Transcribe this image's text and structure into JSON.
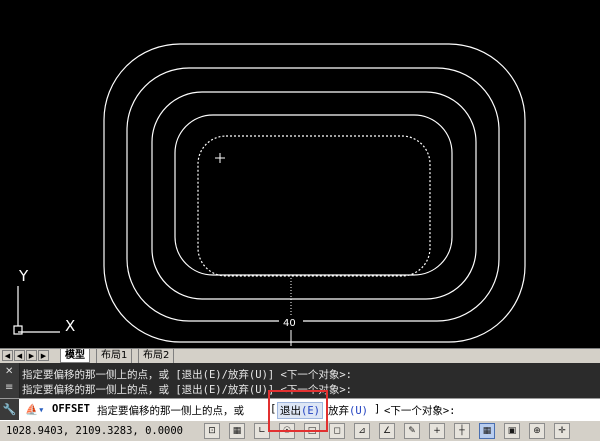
{
  "canvas": {
    "ucs_y_label": "Y",
    "ucs_x_label": "X",
    "dimension_label": "40"
  },
  "tabs": {
    "nav_buttons": [
      "first-icon",
      "prev-icon",
      "next-icon",
      "last-icon"
    ],
    "items": [
      {
        "label": "模型",
        "active": true
      },
      {
        "label": "布局1",
        "active": false
      },
      {
        "label": "布局2",
        "active": false
      }
    ]
  },
  "history": {
    "lines": [
      "指定要偏移的那一侧上的点，或 [退出(E)/放弃(U)] <下一个对象>:",
      "指定要偏移的那一侧上的点，或 [退出(E)/放弃(U)] <下一个对象>:"
    ]
  },
  "command": {
    "command_name": "OFFSET",
    "prompt_text": "指定要偏移的那一侧上的点，或",
    "bracket_open": "[",
    "option_exit_label": "退出",
    "option_exit_key": "(E)",
    "option_undo_label": "放弃",
    "option_undo_key": "(U)",
    "bracket_close": "]",
    "default_text": "<下一个对象>:"
  },
  "statusbar": {
    "coordinates": "1028.9403, 2109.3283, 0.0000",
    "buttons": [
      {
        "name": "snap-mode-icon",
        "glyph": "⊡",
        "on": false
      },
      {
        "name": "grid-display-icon",
        "glyph": "▦",
        "on": false
      },
      {
        "name": "ortho-mode-icon",
        "glyph": "∟",
        "on": false
      },
      {
        "name": "polar-tracking-icon",
        "glyph": "☉",
        "on": false
      },
      {
        "name": "object-snap-icon",
        "glyph": "□",
        "on": false
      },
      {
        "name": "3d-osnap-icon",
        "glyph": "◻",
        "on": false
      },
      {
        "name": "object-snap-tracking-icon",
        "glyph": "⊿",
        "on": false
      },
      {
        "name": "dynamic-ucs-icon",
        "glyph": "∠",
        "on": false
      },
      {
        "name": "dynamic-input-icon",
        "glyph": "✎",
        "on": false
      },
      {
        "name": "lineweight-icon",
        "glyph": "+",
        "on": false
      },
      {
        "name": "transparency-icon",
        "glyph": "┼",
        "on": false
      },
      {
        "name": "quick-properties-icon",
        "glyph": "▦",
        "on": true
      },
      {
        "name": "selection-cycling-icon",
        "glyph": "▣",
        "on": false
      },
      {
        "name": "annotation-monitor-icon",
        "glyph": "⊕",
        "on": false
      },
      {
        "name": "workspace-icon",
        "glyph": "✛",
        "on": false
      }
    ]
  }
}
